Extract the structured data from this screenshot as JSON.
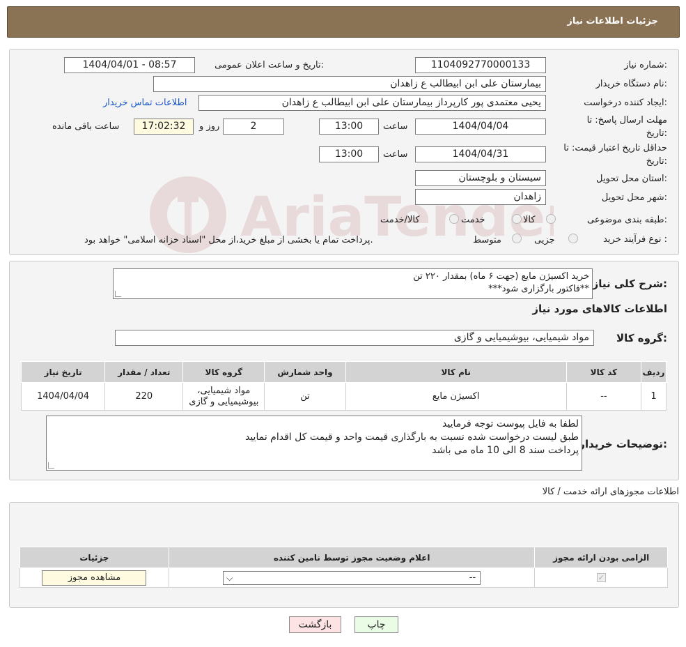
{
  "header": {
    "title": "جزئیات اطلاعات نیاز"
  },
  "info": {
    "need_number_label": "شماره نیاز:",
    "need_number": "1104092770000133",
    "announce_label": "تاریخ و ساعت اعلان عمومی:",
    "announce_value": "1404/04/01 - 08:57",
    "buyer_org_label": "نام دستگاه خریدار:",
    "buyer_org": "بیمارستان علی ابن ابیطالب  ع  زاهدان",
    "creator_label": "ایجاد کننده درخواست:",
    "creator": "یحیی معتمدی پور کارپرداز بیمارستان علی ابن ابیطالب  ع  زاهدان",
    "contact_link": "اطلاعات تماس خریدار",
    "deadline_label_1": "مهلت ارسال پاسخ: تا",
    "deadline_label_2": "تاریخ:",
    "deadline_date": "1404/04/04",
    "time_label": "ساعت",
    "deadline_time": "13:00",
    "days_value": "2",
    "days_label": "روز و",
    "remaining_time": "17:02:32",
    "remaining_label": "ساعت باقی مانده",
    "validity_label_1": "حداقل تاریخ اعتبار قیمت: تا",
    "validity_label_2": "تاریخ:",
    "validity_date": "1404/04/31",
    "validity_time": "13:00",
    "province_label": "استان محل تحویل:",
    "province": "سیستان و بلوچستان",
    "city_label": "شهر محل تحویل:",
    "city": "زاهدان",
    "category_label": "طبقه بندی موضوعی:",
    "category_options": [
      "کالا",
      "خدمت",
      "کالا/خدمت"
    ],
    "purchase_type_label": "نوع فرآیند خرید :",
    "purchase_options": [
      "جزیی",
      "متوسط"
    ],
    "purchase_note": "پرداخت تمام یا بخشی از مبلغ خرید،از محل \"اسناد خزانه اسلامی\" خواهد بود."
  },
  "summary": {
    "label": "شرح کلی نیاز:",
    "line1": "خرید اکسیژن مایع (جهت ۶ ماه) بمقدار ۲۲۰ تن",
    "line2": "**فاکتور بارگزاری شود***",
    "goods_title": "اطلاعات کالاهای مورد نیاز",
    "group_label": "گروه کالا:",
    "group_value": "مواد شیمیایی، بیوشیمیایی و  گازی"
  },
  "goods_table": {
    "headers": [
      "ردیف",
      "کد کالا",
      "نام کالا",
      "واحد شمارش",
      "گروه کالا",
      "تعداد / مقدار",
      "تاریخ نیاز"
    ],
    "rows": [
      [
        "1",
        "--",
        "اکسیژن مایع",
        "تن",
        "مواد شیمیایی، بیوشیمیایی و گازی",
        "220",
        "1404/04/04"
      ]
    ]
  },
  "buyer_notes": {
    "label": "توضیحات خریدار:",
    "line1": "لطفا به فایل پیوست توجه فرمایید",
    "line2": "طبق لیست درخواست شده نسبت به بارگذاری قیمت واحد و قیمت کل اقدام نمایید",
    "line3": "پرداخت سند 8 الی 10 ماه می باشد"
  },
  "permits": {
    "title": "اطلاعات مجوزهای ارائه خدمت / کالا",
    "headers": [
      "الزامی بودن ارائه مجوز",
      "اعلام وضعیت مجوز توسط نامین کننده",
      "جزئیات"
    ],
    "select_value": "--",
    "view_button": "مشاهده مجوز"
  },
  "footer": {
    "print_label": "چاپ",
    "back_label": "بازگشت"
  },
  "watermark_text": "AriaTender.neT"
}
